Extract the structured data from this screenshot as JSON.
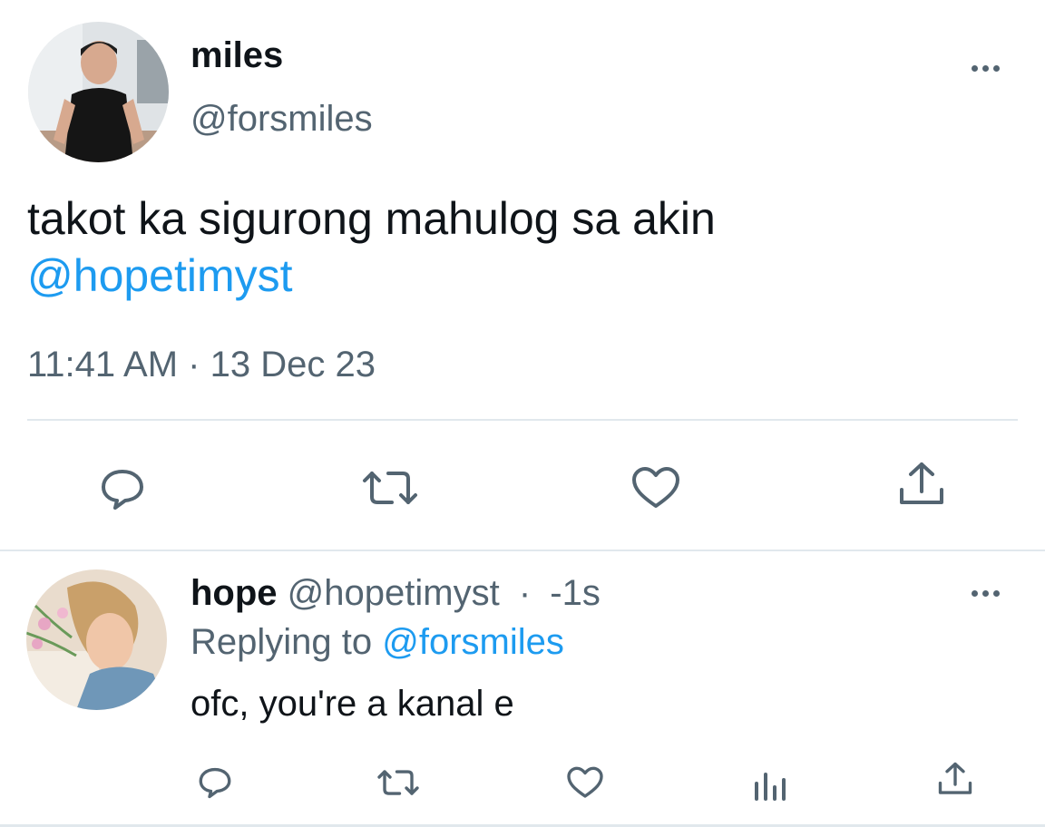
{
  "main_tweet": {
    "author_name": "miles",
    "author_handle": "@forsmiles",
    "text": "takot ka sigurong mahulog sa akin",
    "mention": "@hopetimyst",
    "time": "11:41 AM",
    "separator": "·",
    "date": "13 Dec 23"
  },
  "reply": {
    "author_name": "hope",
    "author_handle": "@hopetimyst",
    "separator": "·",
    "time": "-1s",
    "replying_to_label": "Replying to",
    "replying_to_handle": "@forsmiles",
    "text": "ofc, you're a kanal e"
  },
  "icons": {
    "more": "more-horizontal-icon",
    "reply": "reply-icon",
    "retweet": "retweet-icon",
    "like": "heart-icon",
    "analytics": "analytics-icon",
    "share": "share-icon"
  },
  "colors": {
    "text": "#0f1419",
    "secondary": "#536471",
    "link": "#1d9bf0",
    "divider": "#e1e8ed"
  }
}
